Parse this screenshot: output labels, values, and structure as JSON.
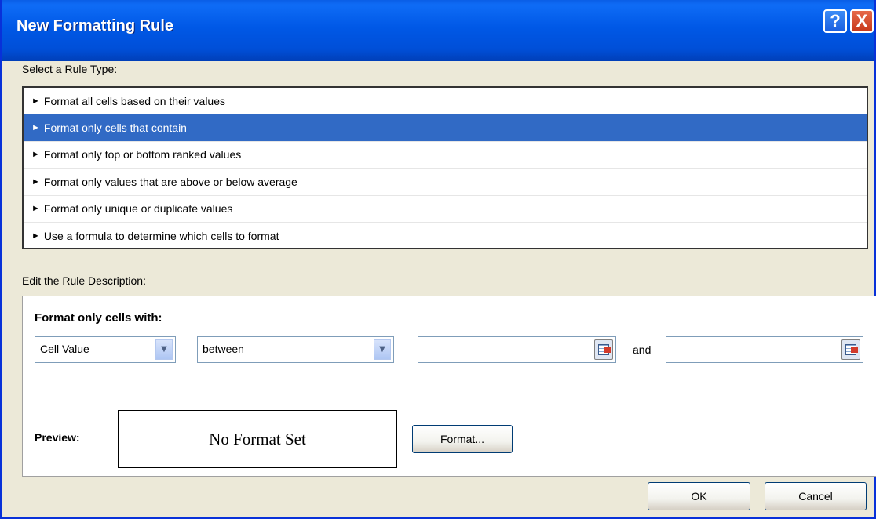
{
  "window": {
    "title": "New Formatting Rule",
    "help": "?",
    "close": "X"
  },
  "rule_type": {
    "label": "Select a Rule Type:",
    "items": [
      {
        "label": "Format all cells based on their values",
        "selected": false
      },
      {
        "label": "Format only cells that contain",
        "selected": true
      },
      {
        "label": "Format only top or bottom ranked values",
        "selected": false
      },
      {
        "label": "Format only values that are above or below average",
        "selected": false
      },
      {
        "label": "Format only unique or duplicate values",
        "selected": false
      },
      {
        "label": "Use a formula to determine which cells to format",
        "selected": false
      }
    ],
    "arrow_glyph": "►"
  },
  "description": {
    "label": "Edit the Rule Description:",
    "subtitle": "Format only cells with:",
    "condition_combo": {
      "value": "Cell Value"
    },
    "operator_combo": {
      "value": "between"
    },
    "value1": "",
    "and_label": "and",
    "value2": "",
    "preview_label": "Preview:",
    "preview_text": "No Format Set",
    "format_button": "Format..."
  },
  "buttons": {
    "ok": "OK",
    "cancel": "Cancel"
  },
  "colors": {
    "title_bar": "#0058e6",
    "selected_row": "#316ac5",
    "dialog_bg": "#ece9d8"
  },
  "icons": [
    "help-icon",
    "close-icon",
    "dropdown-arrow-icon",
    "range-selector-icon",
    "mouse-pointer-icon"
  ]
}
